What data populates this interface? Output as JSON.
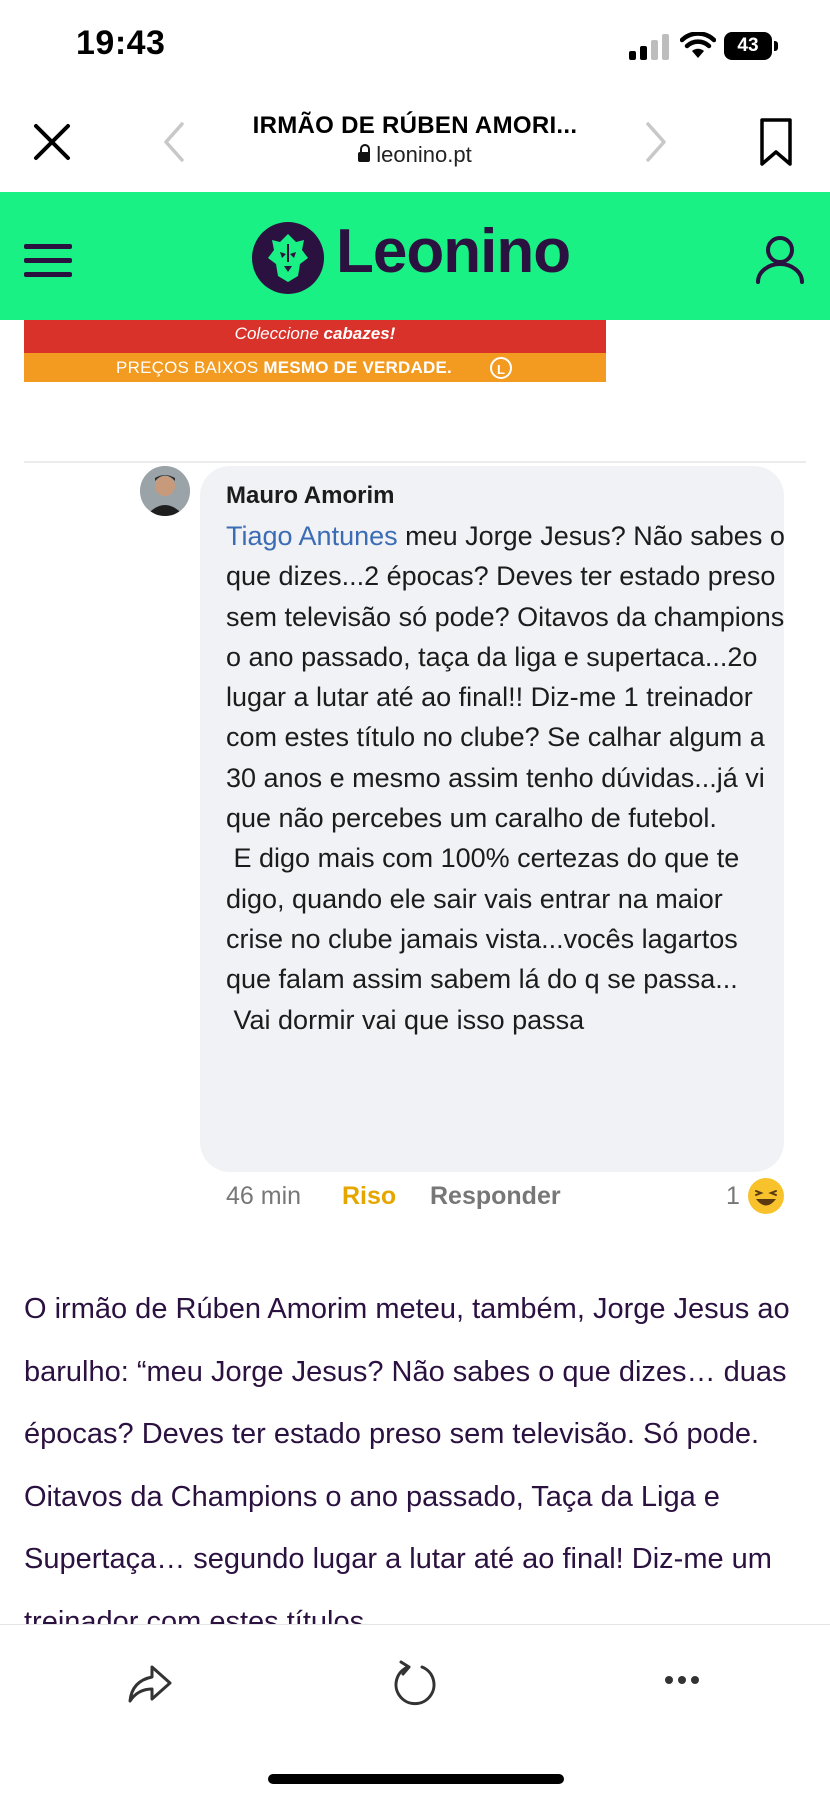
{
  "status_bar": {
    "time": "19:43",
    "battery": "43",
    "icons": [
      "cellular-signal-icon",
      "wifi-icon",
      "battery-icon"
    ]
  },
  "browser": {
    "title": "IRMÃO DE RÚBEN AMORI...",
    "domain": "leonino.pt",
    "icons": [
      "close-icon",
      "back-arrow-icon",
      "forward-arrow-icon",
      "bookmark-icon",
      "lock-icon"
    ]
  },
  "site_nav": {
    "logo_text": "Leonino",
    "background": "#1af184",
    "brand_color": "#2b1140",
    "icons": [
      "hamburger-menu-icon",
      "lion-logo-icon",
      "user-account-icon"
    ]
  },
  "ad": {
    "line1_prefix": "Coleccione ",
    "line1_bold": "cabazes!",
    "line2_prefix": "PREÇOS BAIXOS ",
    "line2_bold": "MESMO DE VERDADE.",
    "badge": "L"
  },
  "comment": {
    "author": "Mauro Amorim",
    "mention": "Tiago Antunes",
    "text": " meu Jorge Jesus? Não sabes o que dizes...2 épocas? Deves ter estado preso sem televisão só pode? Oitavos da champions o ano passado, taça da liga e supertaca...2o lugar a lutar até ao final!! Diz-me 1 treinador com estes título no clube? Se calhar algum a 30 anos e mesmo assim tenho dúvidas...já vi que não percebes um caralho de futebol.\n E digo mais com 100% certezas do que te digo, quando ele sair vais entrar na maior crise no clube jamais vista...vocês lagartos que falam assim sabem lá do q se passa...\n Vai dormir vai que isso passa",
    "time": "46 min",
    "laugh_label": "Riso",
    "reply_label": "Responder",
    "reaction_count": "1",
    "reaction_icon": "laughing-emoji-icon"
  },
  "article": {
    "text": "O irmão de Rúben Amorim meteu, também, Jorge Jesus ao barulho: “meu Jorge Jesus? Não sabes o que dizes… duas épocas? Deves ter estado preso sem televisão. Só pode. Oitavos da Champions o ano passado, Taça da Liga e Supertaça… segundo lugar a lutar até ao final! Diz-me um treinador com estes títulos"
  },
  "toolbar": {
    "icons": [
      "share-icon",
      "reload-icon",
      "more-options-icon"
    ]
  }
}
